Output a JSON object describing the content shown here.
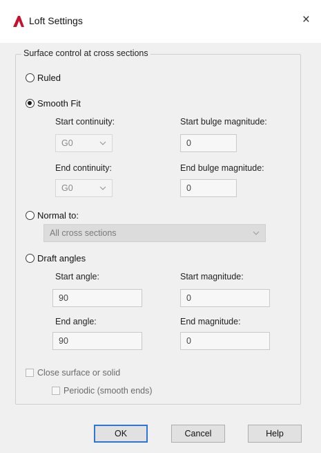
{
  "window": {
    "title": "Loft Settings",
    "close_glyph": "×",
    "icon": "autocad-a-icon",
    "icon_color": "#c8102e"
  },
  "group": {
    "legend": "Surface control at cross sections"
  },
  "options": {
    "ruled": {
      "label": "Ruled",
      "checked": false
    },
    "smooth_fit": {
      "label": "Smooth Fit",
      "checked": true
    },
    "normal_to": {
      "label": "Normal to:",
      "checked": false
    },
    "draft_angles": {
      "label": "Draft angles",
      "checked": false
    }
  },
  "smooth": {
    "start_continuity_label": "Start continuity:",
    "start_continuity_value": "G0",
    "start_bulge_label": "Start bulge magnitude:",
    "start_bulge_value": "0",
    "end_continuity_label": "End continuity:",
    "end_continuity_value": "G0",
    "end_bulge_label": "End bulge magnitude:",
    "end_bulge_value": "0"
  },
  "normal": {
    "selected": "All cross sections"
  },
  "draft": {
    "start_angle_label": "Start angle:",
    "start_angle_value": "90",
    "start_magnitude_label": "Start magnitude:",
    "start_magnitude_value": "0",
    "end_angle_label": "End angle:",
    "end_angle_value": "90",
    "end_magnitude_label": "End magnitude:",
    "end_magnitude_value": "0"
  },
  "checks": {
    "close_surface": {
      "label": "Close surface or solid",
      "checked": false
    },
    "periodic": {
      "label": "Periodic (smooth ends)",
      "checked": false
    }
  },
  "buttons": {
    "ok": "OK",
    "cancel": "Cancel",
    "help": "Help"
  }
}
